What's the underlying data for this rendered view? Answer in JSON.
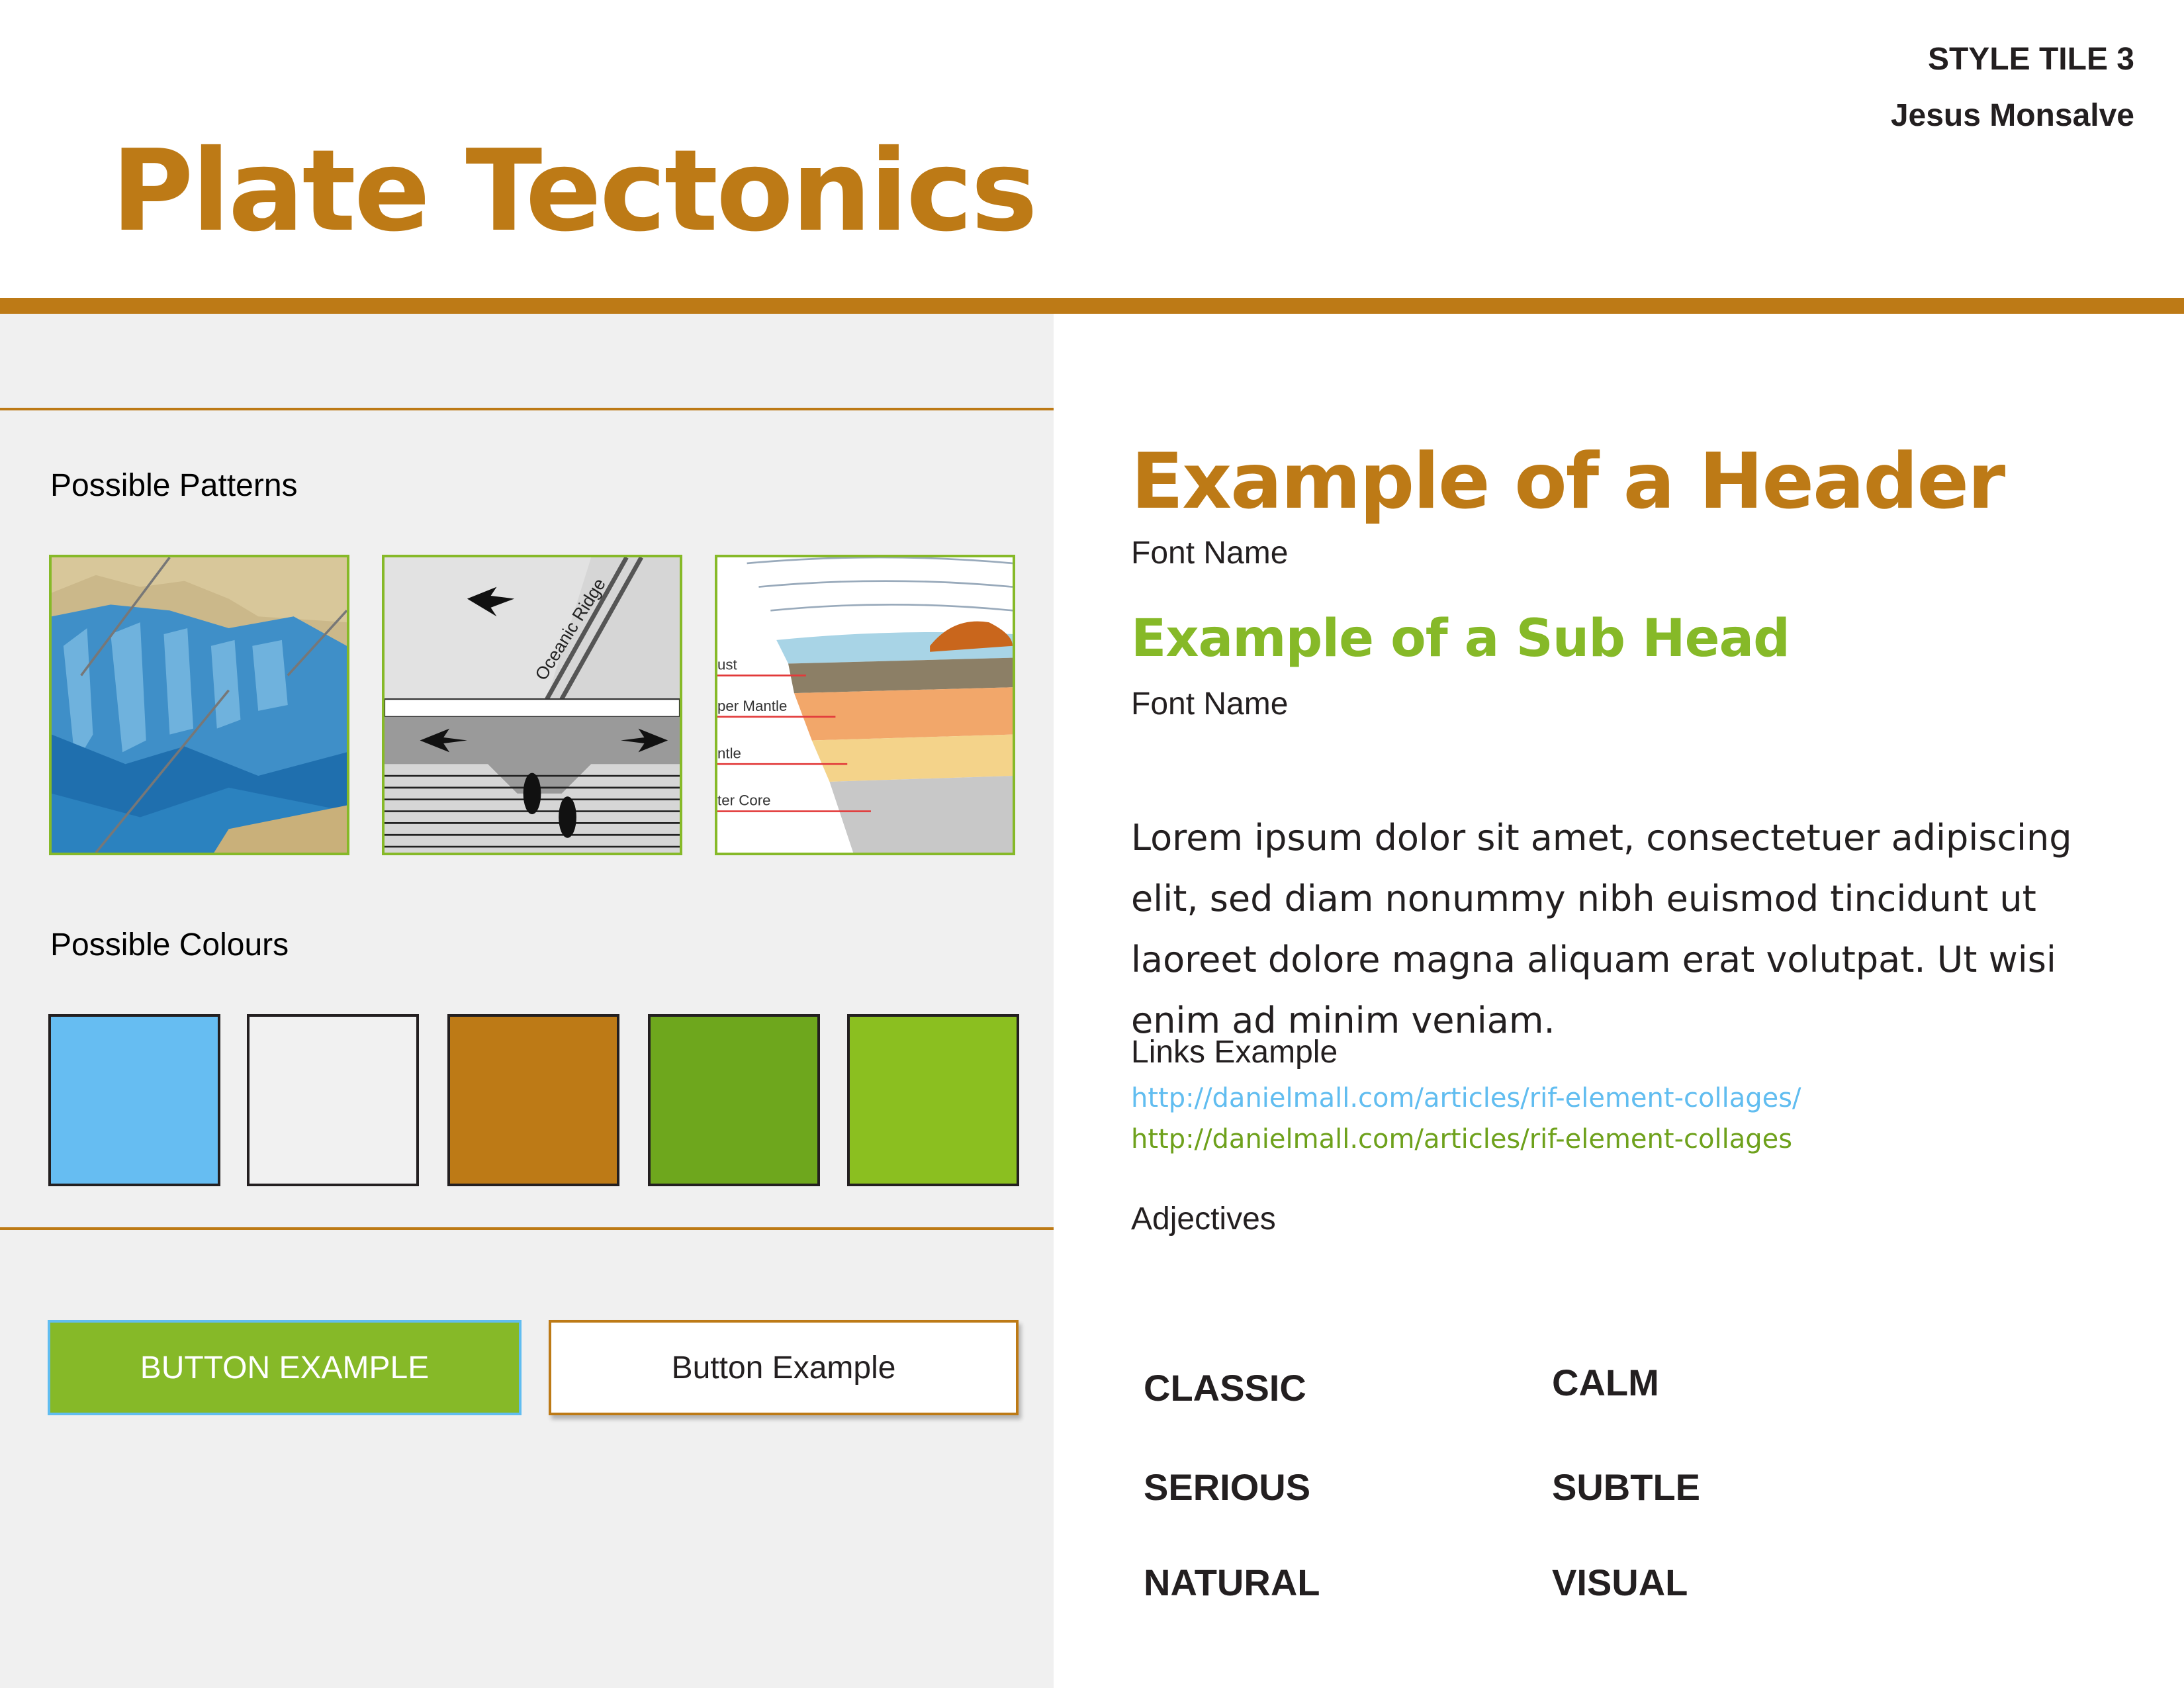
{
  "header": {
    "tile_label": "STYLE TILE 3",
    "author": "Jesus Monsalve",
    "title": "Plate Tectonics"
  },
  "left": {
    "patterns_label": "Possible Patterns",
    "pattern_images": [
      {
        "icon": "ocean-floor-illustration"
      },
      {
        "icon": "oceanic-ridge-diagram",
        "label": "Oceanic Ridge"
      },
      {
        "icon": "earth-layers-diagram",
        "labels": [
          "ust",
          "per Mantle",
          "ntle",
          "ter Core"
        ]
      }
    ],
    "colours_label": "Possible Colours",
    "colours": [
      "#66bdf2",
      "#f1f1f1",
      "#bd7a16",
      "#6ea71d",
      "#8bbf20"
    ],
    "buttons": {
      "primary_label": "BUTTON EXAMPLE",
      "secondary_label": "Button Example"
    }
  },
  "right": {
    "header_example": "Example of a Header",
    "header_font_name": "Font Name",
    "subhead_example": "Example of a Sub Head",
    "subhead_font_name": "Font Name",
    "body_text": "Lorem ipsum dolor sit amet, consectetuer adipiscing elit, sed diam nonummy nibh euismod tincidunt ut laoreet dolore magna aliquam erat volutpat. Ut wisi enim ad minim veniam.",
    "links_label": "Links Example",
    "link_1": "http://danielmall.com/articles/rif-element-collages/",
    "link_2": "http://danielmall.com/articles/rif-element-collages",
    "adjectives_label": "Adjectives",
    "adjectives": [
      "CLASSIC",
      "CALM",
      "SERIOUS",
      "SUBTLE",
      "NATURAL",
      "VISUAL"
    ]
  },
  "colors": {
    "brand_orange": "#bd7a16",
    "brand_green": "#86b928",
    "link_blue": "#61bdf0",
    "panel_grey": "#f0f0f0"
  }
}
